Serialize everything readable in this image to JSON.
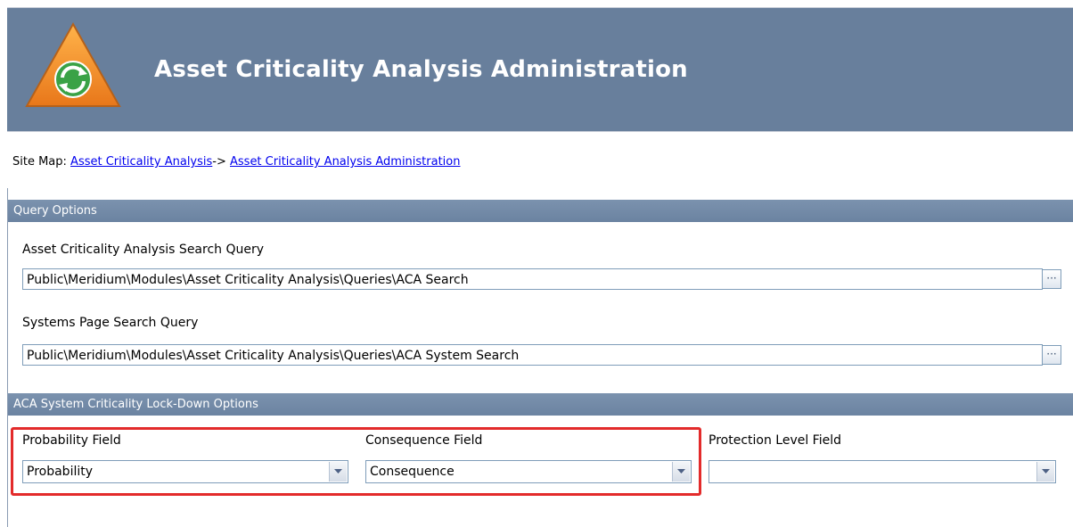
{
  "header": {
    "title": "Asset Criticality Analysis Administration"
  },
  "sitemap": {
    "prefix": "Site Map: ",
    "link1": "Asset Criticality Analysis",
    "separator": "-> ",
    "link2": "Asset Criticality Analysis Administration"
  },
  "query_options": {
    "header": "Query Options",
    "search_query_label": "Asset Criticality Analysis Search Query",
    "search_query_value": "Public\\Meridium\\Modules\\Asset Criticality Analysis\\Queries\\ACA Search",
    "systems_query_label": "Systems Page Search Query",
    "systems_query_value": "Public\\Meridium\\Modules\\Asset Criticality Analysis\\Queries\\ACA System Search",
    "browse_glyph": "···"
  },
  "lockdown": {
    "header": "ACA System Criticality Lock-Down Options",
    "probability_label": "Probability Field",
    "probability_value": "Probability",
    "consequence_label": "Consequence Field",
    "consequence_value": "Consequence",
    "protection_label": "Protection Level Field",
    "protection_value": ""
  },
  "icons": [
    "meridium-logo-icon",
    "browse-icon",
    "dropdown-arrow-icon"
  ],
  "colors": {
    "header_bg": "#687f9c",
    "section_bg": "#7489a6",
    "highlight": "#e32b2b",
    "link": "#0000ee"
  }
}
